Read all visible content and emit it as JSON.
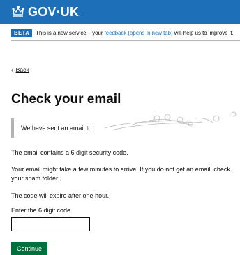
{
  "header": {
    "logo_text": "GOV·UK",
    "logo_icon": "crown-icon"
  },
  "phase_banner": {
    "tag": "BETA",
    "text_before": "This is a new service – your",
    "link_text": "feedback (opens in new tab)",
    "text_after": "will help us to improve it."
  },
  "back_link": {
    "label": "Back",
    "icon": "chevron-left-icon"
  },
  "page_title": "Check your email",
  "inset_text": "We have sent an email to:",
  "paragraphs": [
    "The email contains a 6 digit security code.",
    "Your email might take a few minutes to arrive. If you do not get an email, check your spam folder.",
    "The code will expire after one hour."
  ],
  "code_field": {
    "label": "Enter the 6 digit code",
    "value": ""
  },
  "continue_button": {
    "label": "Continue"
  },
  "colors": {
    "brand_blue": "#1d70b8",
    "button_green": "#00703c",
    "text": "#0b0c0c",
    "border_grey": "#b1b4b6"
  }
}
